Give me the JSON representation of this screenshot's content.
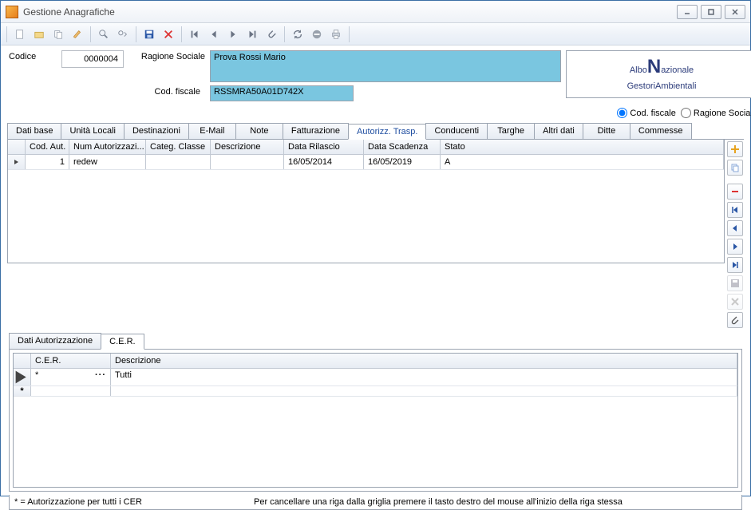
{
  "window": {
    "title": "Gestione Anagrafiche"
  },
  "header": {
    "codice_label": "Codice",
    "codice_value": "0000004",
    "ragione_label": "Ragione Sociale",
    "ragione_value": "Prova Rossi Mario",
    "codfisc_label": "Cod. fiscale",
    "codfisc_value": "RSSMRA50A01D742X",
    "logo_line1a": "Albo",
    "logo_line1b": "N",
    "logo_line1c": "azionale",
    "logo_line2a": "G",
    "logo_line2b": "estori",
    "logo_line2c": "A",
    "logo_line2d": "mbientali",
    "radio_codfisc": "Cod. fiscale",
    "radio_ragione": "Ragione Sociale"
  },
  "tabs": {
    "t0": "Dati base",
    "t1": "Unità Locali",
    "t2": "Destinazioni",
    "t3": "E-Mail",
    "t4": "Note",
    "t5": "Fatturazione",
    "t6": "Autorizz. Trasp.",
    "t7": "Conducenti",
    "t8": "Targhe",
    "t9": "Altri dati",
    "t10": "Ditte",
    "t11": "Commesse"
  },
  "grid": {
    "h1": "Cod. Aut.",
    "h2": "Num Autorizzazi...",
    "h3": "Categ. Classe",
    "h4": "Descrizione",
    "h5": "Data Rilascio",
    "h6": "Data Scadenza",
    "h7": "Stato",
    "r1": {
      "codaut": "1",
      "numaut": "redew",
      "categ": "",
      "descr": "",
      "rilascio": "16/05/2014",
      "scadenza": "16/05/2019",
      "stato": "A"
    }
  },
  "subtabs": {
    "s0": "Dati Autorizzazione",
    "s1": "C.E.R."
  },
  "subgrid": {
    "h1": "C.E.R.",
    "h2": "Descrizione",
    "r1": {
      "cer": "*",
      "descr": "Tutti"
    },
    "newmark": "*"
  },
  "footer": {
    "left": "* = Autorizzazione per tutti i CER",
    "right": "Per cancellare una riga dalla griglia premere il tasto destro del mouse all'inizio della riga stessa"
  }
}
